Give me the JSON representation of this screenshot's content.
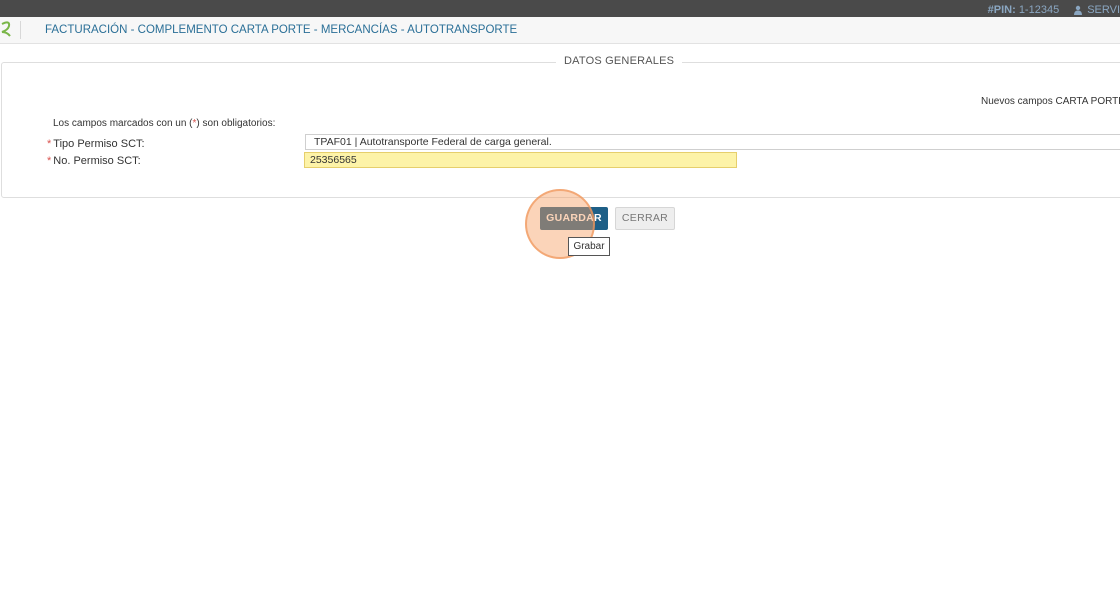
{
  "header": {
    "pin_label": "#PIN:",
    "pin_value": "1-12345",
    "user": "SERVI",
    "title": "FACTURACIÓN - COMPLEMENTO CARTA PORTE - MERCANCÍAS - AUTOTRANSPORTE"
  },
  "form": {
    "section_title": "DATOS GENERALES",
    "notice": "Nuevos campos CARTA PORTE ver",
    "required_note_pre": "Los campos marcados con un (",
    "required_note_star": "*",
    "required_note_post": ") son obligatorios:",
    "tipo_permiso_label": "Tipo Permiso SCT:",
    "tipo_permiso_value": "TPAF01 | Autotransporte Federal de carga general.",
    "no_permiso_label": "No. Permiso SCT:",
    "no_permiso_value": "25356565",
    "required_marker": "*"
  },
  "actions": {
    "save_label": "GUARDAR",
    "close_label": "CERRAR",
    "tooltip": "Grabar"
  },
  "colors": {
    "accent": "#1e5f87",
    "title": "#2a6f97",
    "required": "#d9534f",
    "highlight_input": "#fdf3a8"
  }
}
